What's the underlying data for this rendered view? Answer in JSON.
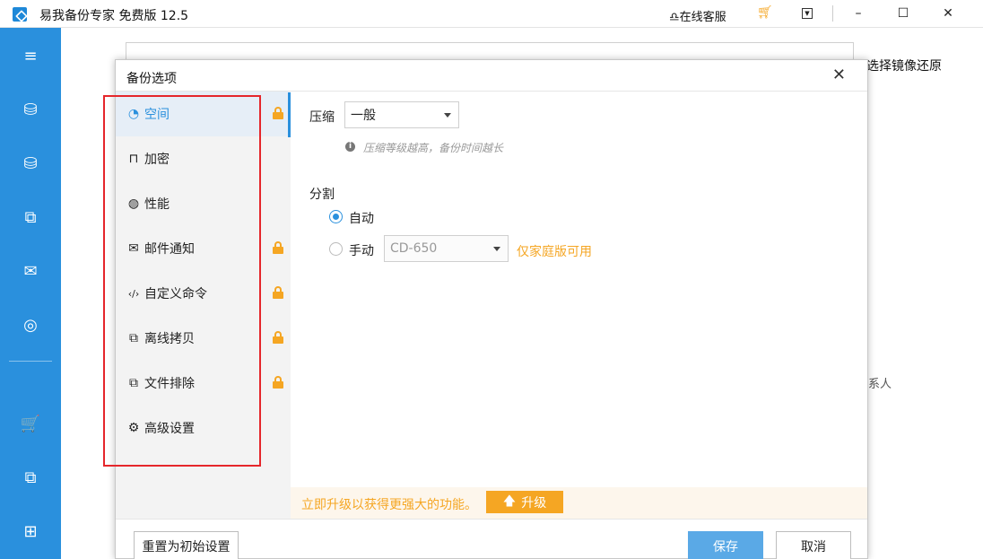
{
  "titlebar": {
    "title": "易我备份专家 免费版 12.5",
    "service": "在线客服",
    "minimize": "–",
    "maximize": "☐",
    "close": "✕"
  },
  "sidebar": {
    "items": [
      {
        "icon": "menu-icon",
        "glyph": "≡"
      },
      {
        "icon": "disk-backup-icon",
        "glyph": "⛁"
      },
      {
        "icon": "system-backup-icon",
        "glyph": "⛁"
      },
      {
        "icon": "file-backup-icon",
        "glyph": "⧉"
      },
      {
        "icon": "mail-backup-icon",
        "glyph": "✉"
      },
      {
        "icon": "smart-backup-icon",
        "glyph": "◎"
      },
      {
        "icon": "cart-icon",
        "glyph": "🛒"
      },
      {
        "icon": "clone-icon",
        "glyph": "⧉"
      },
      {
        "icon": "tools-icon",
        "glyph": "⊞"
      }
    ]
  },
  "background": {
    "restore_link": "选择镜像还原",
    "contact": "系人"
  },
  "dialog": {
    "title": "备份选项",
    "close": "✕",
    "nav": [
      {
        "label": "空间",
        "icon": "pie-chart-icon",
        "glyph": "◔",
        "locked": true,
        "active": true
      },
      {
        "label": "加密",
        "icon": "lock-icon",
        "glyph": "⊓",
        "locked": false,
        "active": false
      },
      {
        "label": "性能",
        "icon": "gauge-icon",
        "glyph": "◍",
        "locked": false,
        "active": false
      },
      {
        "label": "邮件通知",
        "icon": "mail-icon",
        "glyph": "✉",
        "locked": true,
        "active": false
      },
      {
        "label": "自定义命令",
        "icon": "code-icon",
        "glyph": "‹/›",
        "locked": true,
        "active": false
      },
      {
        "label": "离线拷贝",
        "icon": "copy-icon",
        "glyph": "⧉",
        "locked": true,
        "active": false
      },
      {
        "label": "文件排除",
        "icon": "exclude-icon",
        "glyph": "⧉",
        "locked": true,
        "active": false
      },
      {
        "label": "高级设置",
        "icon": "gear-icon",
        "glyph": "⚙",
        "locked": false,
        "active": false
      }
    ],
    "compression": {
      "label": "压缩",
      "value": "一般",
      "hint": "压缩等级越高，备份时间越长"
    },
    "split": {
      "label": "分割",
      "auto_label": "自动",
      "manual_label": "手动",
      "manual_value": "CD-650",
      "home_only": "仅家庭版可用",
      "selected": "auto"
    },
    "upgrade": {
      "text": "立即升级以获得更强大的功能。",
      "button": "升级"
    },
    "buttons": {
      "reset": "重置为初始设置",
      "save": "保存",
      "cancel": "取消"
    }
  },
  "colors": {
    "accent": "#2a90dd",
    "warning": "#f5a623",
    "highlight_border": "#e5262b"
  }
}
